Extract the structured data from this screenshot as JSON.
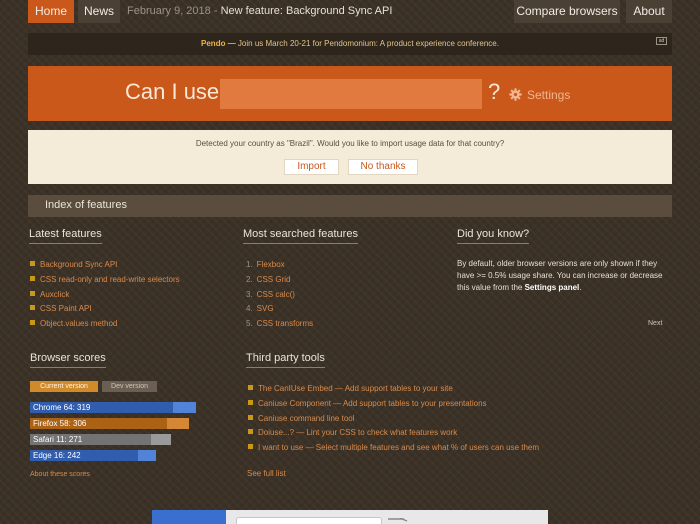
{
  "nav": {
    "home": "Home",
    "news": "News",
    "news_date": "February 9, 2018",
    "news_sep": " - ",
    "news_feature": "New feature: Background Sync API",
    "compare": "Compare browsers",
    "about": "About"
  },
  "sponsor": {
    "brand": "Pendo",
    "dash": " — ",
    "text": "Join us March 20-21 for Pendomonium: A product experience conference.",
    "ad_label": "ad"
  },
  "hero": {
    "title": "Can I use",
    "search_placeholder": "",
    "question": "?",
    "settings": "Settings"
  },
  "import_prompt": {
    "text": "Detected your country as \"Brazil\". Would you like to import usage data for that country?",
    "import": "Import",
    "no_thanks": "No thanks"
  },
  "index_title": "Index of features",
  "latest": {
    "heading": "Latest features",
    "items": [
      "Background Sync API",
      "CSS read-only and read-write selectors",
      "Auxclick",
      "CSS Paint API",
      "Object.values method"
    ]
  },
  "most_searched": {
    "heading": "Most searched features",
    "items": [
      {
        "num": "1.",
        "label": "Flexbox"
      },
      {
        "num": "2.",
        "label": "CSS Grid"
      },
      {
        "num": "3.",
        "label": "CSS calc()"
      },
      {
        "num": "4.",
        "label": "SVG"
      },
      {
        "num": "5.",
        "label": "CSS transforms"
      }
    ]
  },
  "did_you_know": {
    "heading": "Did you know?",
    "text": "By default, older browser versions are only shown if they have >= 0.5% usage share. You can increase or decrease this value from the ",
    "link": "Settings panel",
    "end": ".",
    "next": "Next"
  },
  "browser_scores": {
    "heading": "Browser scores",
    "tab_current": "Current version",
    "tab_dev": "Dev version",
    "items": [
      {
        "label": "Chrome 64: 319",
        "score": 319,
        "color": "#3a72d4"
      },
      {
        "label": "Firefox 58: 306",
        "score": 306,
        "color": "#d0771a"
      },
      {
        "label": "Safari 11: 271",
        "score": 271,
        "color": "#8c8c8c"
      },
      {
        "label": "Edge 16: 242",
        "score": 242,
        "color": "#3a72d4"
      }
    ],
    "max_score": 350,
    "about": "About these scores"
  },
  "third_party": {
    "heading": "Third party tools",
    "items": [
      "The CanIUse Embed — Add support tables to your site",
      "Caniuse Component — Add support tables to your presentations",
      "Caniuse command line tool",
      "Doiuse...? — Lint your CSS to check what features work",
      "I want to use — Select multiple features and see what % of users can use them"
    ],
    "see_full": "See full list"
  },
  "colors": {
    "accent": "#c9581a",
    "background": "#3b3126",
    "link": "#d98a4a"
  }
}
